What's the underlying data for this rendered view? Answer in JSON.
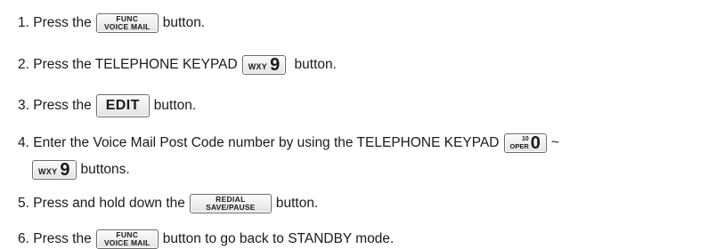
{
  "steps": [
    {
      "num": "1.",
      "before": "Press the",
      "key": {
        "top": "FUNC",
        "bottom": "VOICE MAIL"
      },
      "after": "button."
    },
    {
      "num": "2.",
      "before": "Press the TELEPHONE KEYPAD",
      "key": {
        "small": "WXY",
        "big": "9"
      },
      "after": "button."
    },
    {
      "num": "3.",
      "before": "Press the",
      "key": {
        "label": "EDIT"
      },
      "after": "button."
    },
    {
      "num": "4.",
      "before": "Enter the Voice Mail Post Code number by using the TELEPHONE KEYPAD",
      "key": {
        "top": "10",
        "bottom": "OPER",
        "big": "0"
      },
      "tilde": "~",
      "key2": {
        "small": "WXY",
        "big": "9"
      },
      "after": "buttons."
    },
    {
      "num": "5.",
      "before": "Press and hold down the",
      "key": {
        "top": "REDIAL",
        "bottom": "SAVE/PAUSE"
      },
      "after": "button."
    },
    {
      "num": "6.",
      "before": "Press the",
      "key": {
        "top": "FUNC",
        "bottom": "VOICE MAIL"
      },
      "after": "button to go back to STANDBY mode."
    }
  ]
}
